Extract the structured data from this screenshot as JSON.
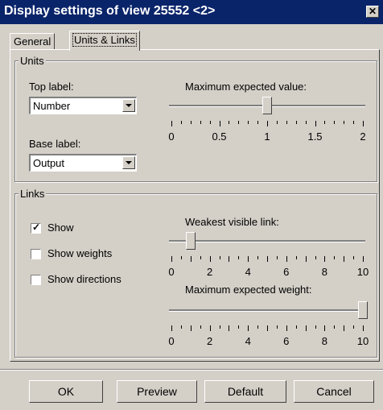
{
  "window": {
    "title": "Display settings of view 25552 <2>",
    "close_glyph": "✕"
  },
  "tabs": [
    {
      "label": "General"
    },
    {
      "label": "Units & Links"
    }
  ],
  "units": {
    "group_title": "Units",
    "top_label": {
      "label": "Top label:",
      "value": "Number"
    },
    "base_label": {
      "label": "Base label:",
      "value": "Output"
    },
    "max_value": {
      "label": "Maximum expected value:",
      "min": 0,
      "max": 2,
      "value": 1,
      "ticks": [
        "0",
        "0.5",
        "1",
        "1.5",
        "2"
      ]
    }
  },
  "links": {
    "group_title": "Links",
    "show": {
      "label": "Show",
      "checked": true
    },
    "show_weights": {
      "label": "Show weights",
      "checked": false
    },
    "show_directions": {
      "label": "Show directions",
      "checked": false
    },
    "weakest": {
      "label": "Weakest visible link:",
      "min": 0,
      "max": 10,
      "value": 1,
      "ticks": [
        "0",
        "2",
        "4",
        "6",
        "8",
        "10"
      ]
    },
    "max_weight": {
      "label": "Maximum expected weight:",
      "min": 0,
      "max": 10,
      "value": 10,
      "ticks": [
        "0",
        "2",
        "4",
        "6",
        "8",
        "10"
      ]
    }
  },
  "buttons": {
    "ok": "OK",
    "preview": "Preview",
    "default": "Default",
    "cancel": "Cancel"
  }
}
